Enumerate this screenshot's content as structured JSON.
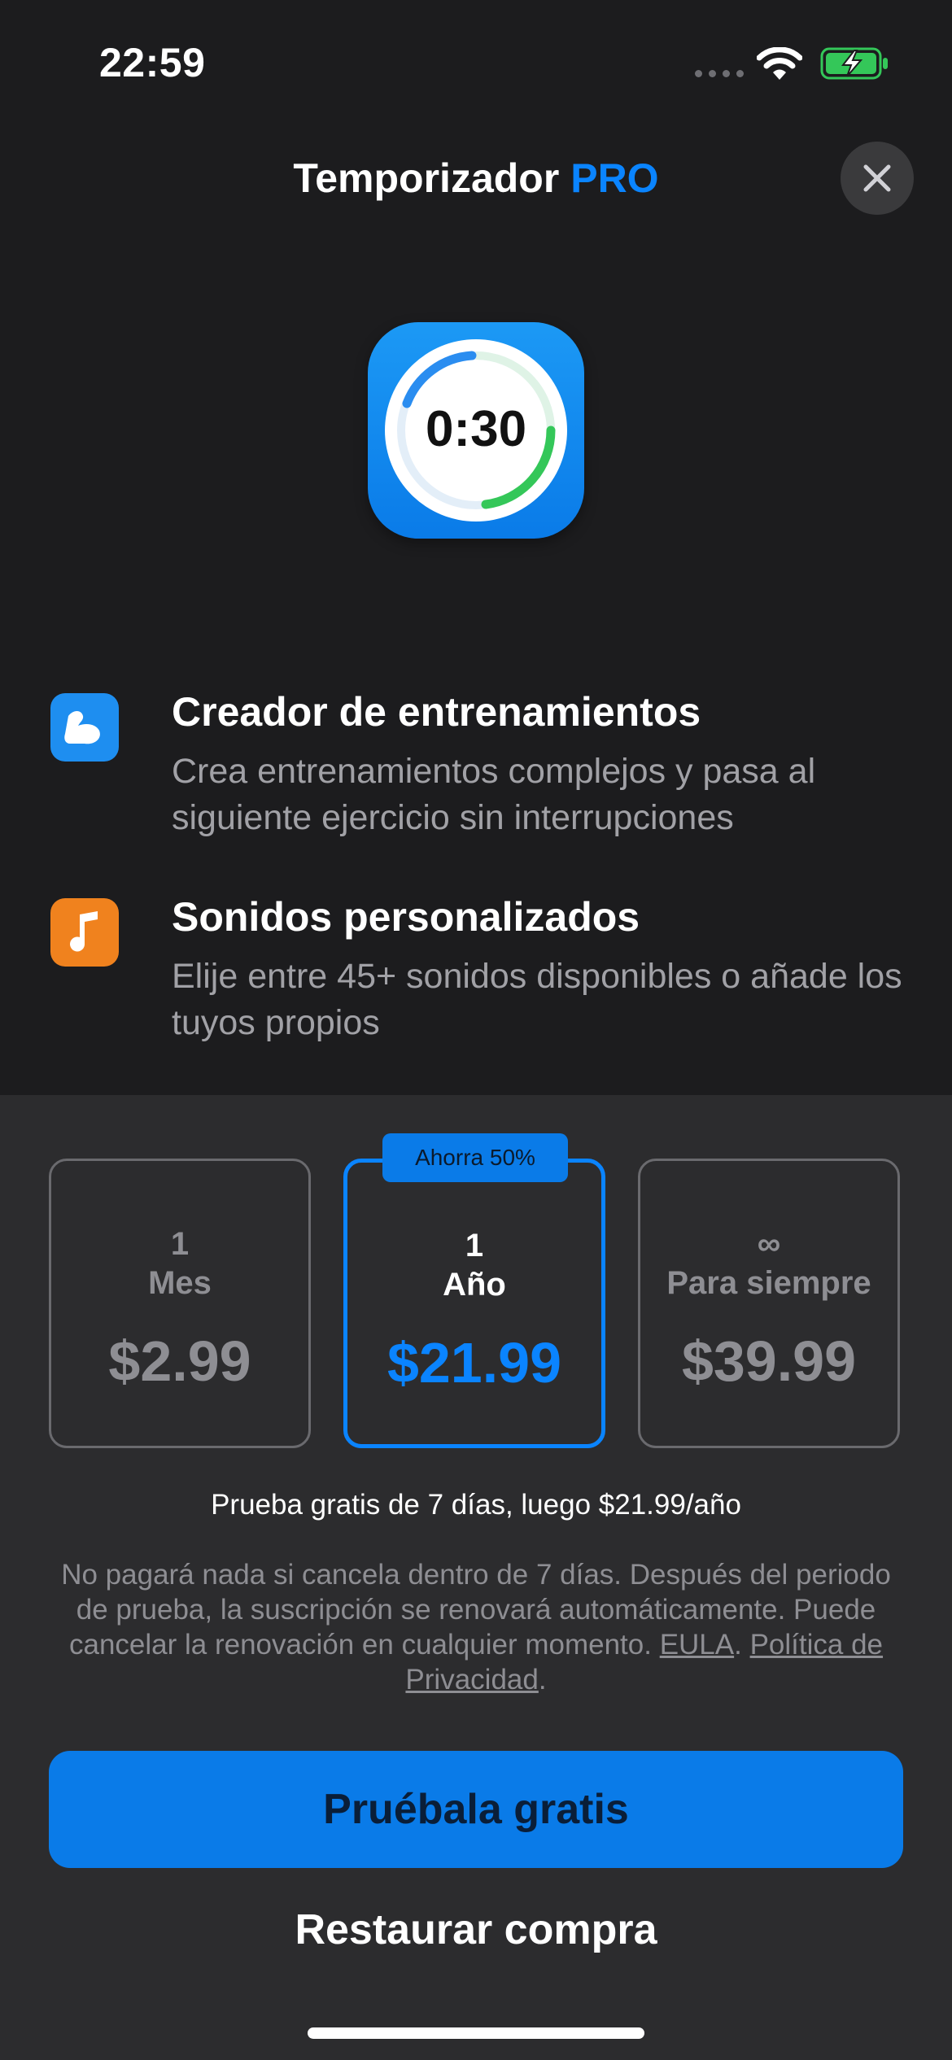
{
  "status_bar": {
    "time": "22:59"
  },
  "header": {
    "title": "Temporizador",
    "title_accent": "PRO"
  },
  "app_icon": {
    "label": "0:30"
  },
  "features": [
    {
      "icon": "flexed-arm-icon",
      "title": "Creador de entrenamientos",
      "description": "Crea entrenamientos complejos y pasa al siguiente ejercicio sin interrupciones"
    },
    {
      "icon": "music-note-icon",
      "title": "Sonidos personalizados",
      "description": "Elije entre 45+ sonidos disponibles o añade los tuyos propios"
    }
  ],
  "plans": [
    {
      "line1": "1",
      "line2": "Mes",
      "price": "$2.99",
      "selected": false
    },
    {
      "line1": "1",
      "line2": "Año",
      "price": "$21.99",
      "selected": true
    },
    {
      "line1": "∞",
      "line2": "Para siempre",
      "price": "$39.99",
      "selected": false
    }
  ],
  "badge": "Ahorra 50%",
  "trial_text": "Prueba gratis de 7 días, luego $21.99/año",
  "legal": {
    "text": "No pagará nada si cancela dentro de 7 días. Después del periodo de prueba, la suscripción se renovará automáticamente. Puede cancelar la renovación en cualquier momento.",
    "eula": "EULA",
    "privacy": "Política de Privacidad"
  },
  "cta_label": "Pruébala gratis",
  "restore_label": "Restaurar compra",
  "colors": {
    "accent": "#0a84ff",
    "background": "#1c1c1e",
    "sheet": "#2c2c2e",
    "orange": "#f0821e",
    "green": "#34c759"
  }
}
